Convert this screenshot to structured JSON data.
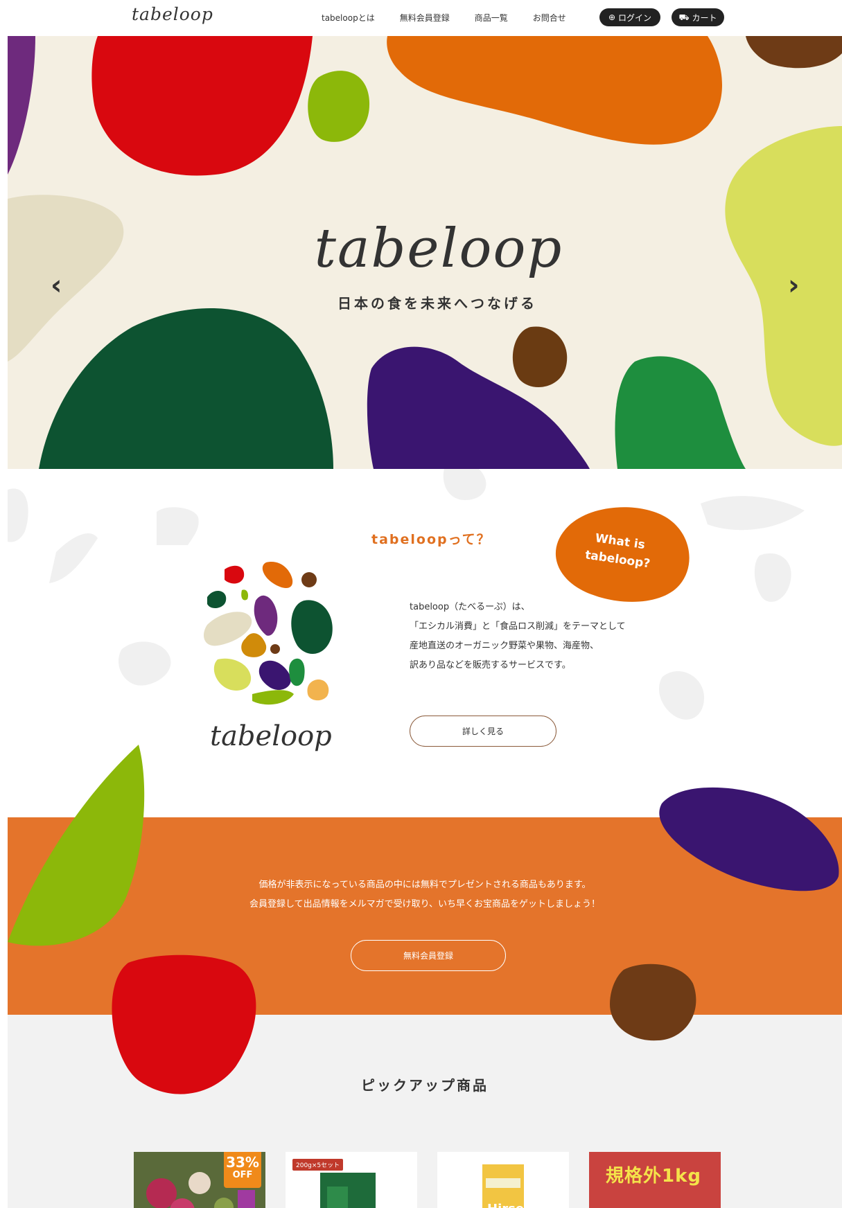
{
  "header": {
    "logo": "tabeloop",
    "nav": [
      {
        "label": "tabeloopとは"
      },
      {
        "label": "無料会員登録"
      },
      {
        "label": "商品一覧"
      },
      {
        "label": "お問合せ"
      }
    ],
    "login_label": "ログイン",
    "cart_label": "カート"
  },
  "hero": {
    "title": "tabeloop",
    "subtitle": "日本の食を未来へつなげる",
    "prev_icon": "chevron-left-icon",
    "next_icon": "chevron-right-icon"
  },
  "about": {
    "title": "tabeloopって？",
    "badge_line1": "What is",
    "badge_line2": "tabeloop?",
    "description": [
      "tabeloop（たべるーぷ）は、",
      "「エシカル消費」と「食品ロス削減」をテーマとして",
      "産地直送のオーガニック野菜や果物、海産物、",
      "訳あり品などを販売するサービスです。"
    ],
    "more_button": "詳しく見る",
    "logo_text": "tabeloop"
  },
  "promo": {
    "line1": "価格が非表示になっている商品の中には無料でプレゼントされる商品もあります。",
    "line2": "会員登録して出品情報をメルマガで受け取り、いち早くお宝商品をゲットしましょう！",
    "button": "無料会員登録"
  },
  "pickup": {
    "title": "ピックアップ商品",
    "cards": [
      {
        "badge": "33%",
        "badge_sub": "OFF"
      },
      {
        "tag": "200g×5セット"
      },
      {
        "label": "Hirse"
      },
      {
        "label": "規格外1kg"
      }
    ]
  },
  "colors": {
    "accent_orange": "#e4742b",
    "title_orange": "#e07020",
    "hero_bg": "#f4efe2"
  }
}
